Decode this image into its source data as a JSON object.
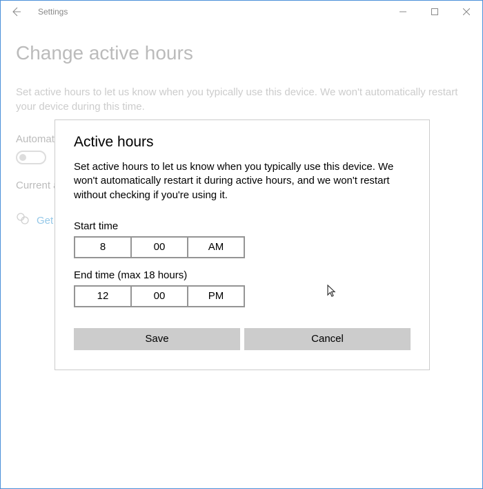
{
  "titlebar": {
    "app_title": "Settings"
  },
  "page": {
    "title": "Change active hours",
    "description": "Set active hours to let us know when you typically use this device. We won't automatically restart your device during this time.",
    "auto_label": "Automati",
    "current_label": "Current a",
    "help_link": "Get"
  },
  "dialog": {
    "title": "Active hours",
    "description": "Set active hours to let us know when you typically use this device. We won't automatically restart it during active hours, and we won't restart without checking if you're using it.",
    "start_label": "Start time",
    "start_time": {
      "hour": "8",
      "minute": "00",
      "period": "AM"
    },
    "end_label": "End time (max 18 hours)",
    "end_time": {
      "hour": "12",
      "minute": "00",
      "period": "PM"
    },
    "save_button": "Save",
    "cancel_button": "Cancel"
  }
}
